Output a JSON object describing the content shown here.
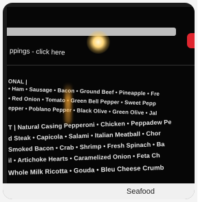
{
  "toppings_link": "ppings - click here",
  "menu_lines": [
    "ONAL |",
    "• Ham • Sausage • Bacon • Ground Beef • Pineapple • Fre",
    "• Red Onion • Tomato • Green Bell Pepper • Sweet Pepp",
    "epper • Poblano Pepper • Black Olive • Green Olive • Jal",
    "T | Natural Casing Pepperoni • Chicken • Peppadew Pe",
    "d Steak • Capicola • Salami • Italian Meatball • Chor",
    "Smoked Bacon • Crab • Shrimp • Fresh Spinach • Ba",
    "il • Artichoke Hearts • Caramelized Onion • Feta Ch",
    "Whole Milk Ricotta • Gouda • Bleu Cheese Crumb"
  ],
  "footer_label": "Seafood"
}
